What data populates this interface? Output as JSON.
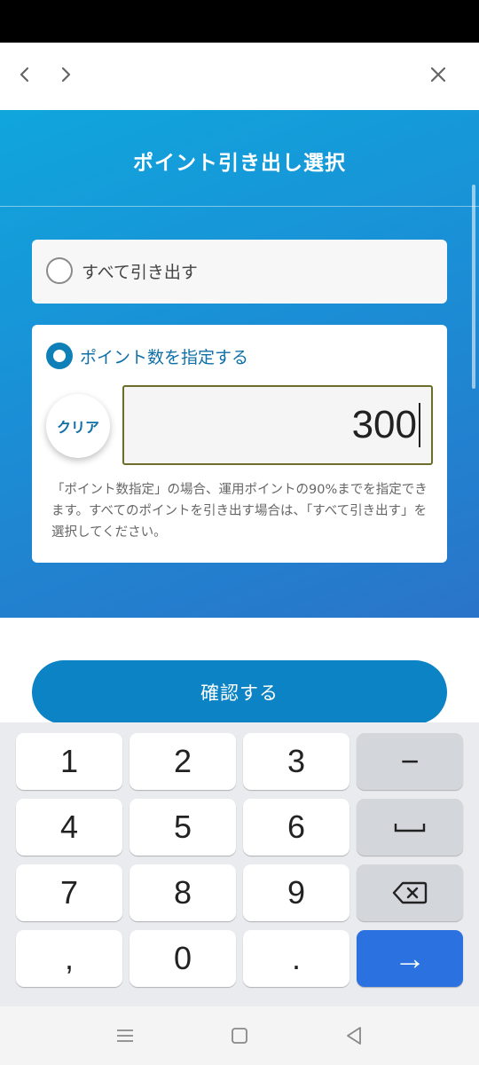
{
  "browser": {
    "back_icon": "chevron-left-icon",
    "forward_icon": "chevron-right-icon",
    "close_icon": "close-icon"
  },
  "page": {
    "title": "ポイント引き出し選択"
  },
  "options": {
    "all_label": "すべて引き出す",
    "specify_label": "ポイント数を指定する",
    "selected": "specify"
  },
  "input": {
    "clear_label": "クリア",
    "value": "300"
  },
  "note": "「ポイント数指定」の場合、運用ポイントの90%までを指定できます。すべてのポイントを引き出す場合は、「すべて引き出す」を選択してください。",
  "confirm_label": "確認する",
  "keyboard": {
    "keys": [
      "1",
      "2",
      "3",
      "−",
      "4",
      "5",
      "6",
      "space-icon",
      "7",
      "8",
      "9",
      "backspace-icon",
      ",",
      "0",
      ".",
      "enter-icon"
    ],
    "k1": "1",
    "k2": "2",
    "k3": "3",
    "minus": "−",
    "k4": "4",
    "k5": "5",
    "k6": "6",
    "k7": "7",
    "k8": "8",
    "k9": "9",
    "comma": ",",
    "k0": "0",
    "period": ".",
    "enter_glyph": "→"
  },
  "colors": {
    "hero_start": "#10a6dc",
    "hero_end": "#2a74c9",
    "accent": "#0b83c5",
    "enter_key": "#2b72e0"
  }
}
